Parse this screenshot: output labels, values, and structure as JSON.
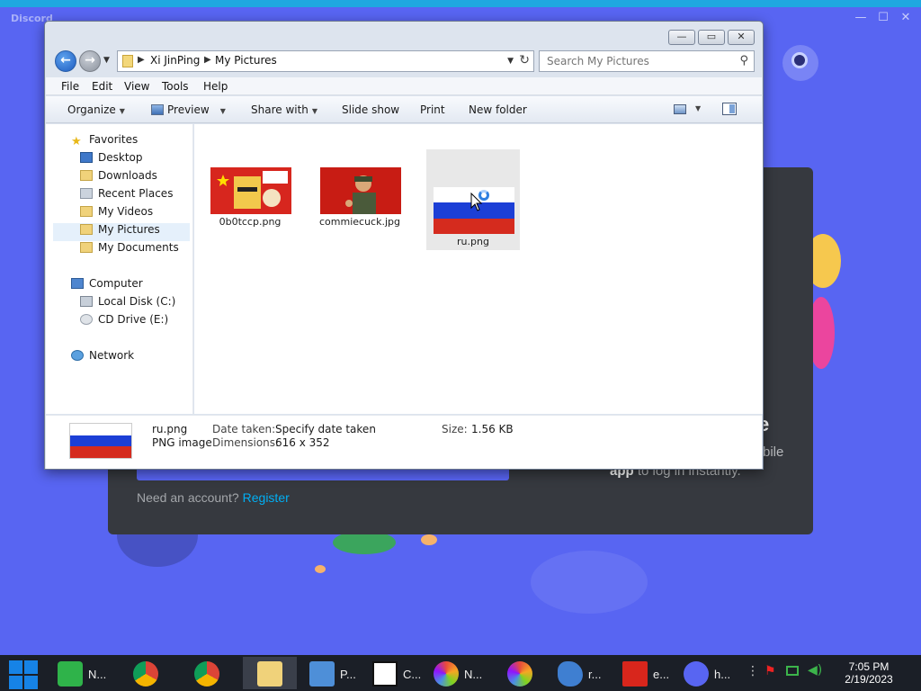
{
  "discord": {
    "title": "Discord",
    "need_account": "Need an account?",
    "register": "Register",
    "qr_heading_fragment": "e",
    "qr_text_fragment": "bile",
    "qr_text_app": "app",
    "qr_text_rest": " to log in instantly."
  },
  "explorer": {
    "breadcrumb": [
      "Xi JinPing",
      "My Pictures"
    ],
    "search_placeholder": "Search My Pictures",
    "window_buttons": {
      "minimize": "—",
      "maximize": "▭",
      "close": "✕"
    },
    "menu": [
      "File",
      "Edit",
      "View",
      "Tools",
      "Help"
    ],
    "commands": {
      "organize": "Organize",
      "preview": "Preview",
      "share_with": "Share with",
      "slide_show": "Slide show",
      "print": "Print",
      "new_folder": "New folder"
    },
    "nav": {
      "favorites": "Favorites",
      "desktop": "Desktop",
      "downloads": "Downloads",
      "recent_places": "Recent Places",
      "my_videos": "My Videos",
      "my_pictures": "My Pictures",
      "my_documents": "My Documents",
      "computer": "Computer",
      "local_disk": "Local Disk (C:)",
      "cd_drive": "CD Drive (E:)",
      "network": "Network"
    },
    "files": [
      {
        "name": "0b0tccp.png"
      },
      {
        "name": "commiecuck.jpg"
      },
      {
        "name": "ru.png",
        "selected": true
      }
    ],
    "details": {
      "name": "ru.png",
      "type": "PNG image",
      "date_label": "Date taken:",
      "date_value": "Specify date taken",
      "dims_label": "Dimensions:",
      "dims_value": "616 x 352",
      "size_label": "Size:",
      "size_value": "1.56 KB"
    }
  },
  "taskbar": {
    "items": [
      {
        "label": "N..."
      },
      {
        "label": ""
      },
      {
        "label": ""
      },
      {
        "label": ""
      },
      {
        "label": "P..."
      },
      {
        "label": "C..."
      },
      {
        "label": "N..."
      },
      {
        "label": ""
      },
      {
        "label": "r..."
      },
      {
        "label": "e..."
      },
      {
        "label": "h..."
      }
    ],
    "time": "7:05 PM",
    "date": "2/19/2023"
  },
  "colors": {
    "discord_blurple": "#5865f2",
    "discord_card": "#36393f",
    "link": "#00aff4",
    "selection": "#e5f0fb",
    "taskbar": "#1b1f27"
  }
}
